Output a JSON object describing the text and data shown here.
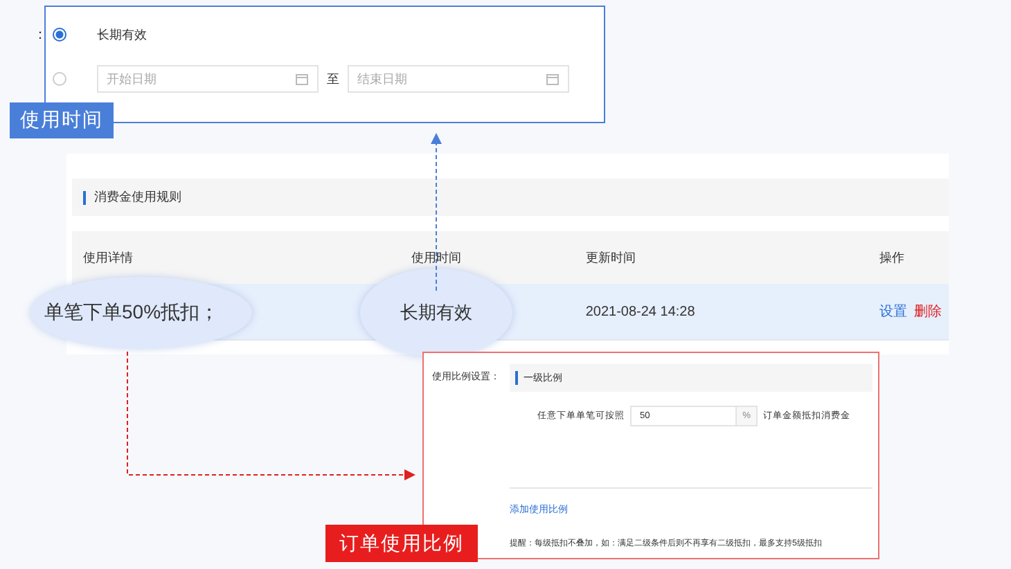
{
  "time_callout": {
    "label_tail": "：",
    "tag": "使用时间",
    "options": [
      {
        "label": "长期有效",
        "selected": true
      },
      {
        "selected": false,
        "start_placeholder": "开始日期",
        "separator": "至",
        "end_placeholder": "结束日期"
      }
    ]
  },
  "rules_panel": {
    "title": "消费金使用规则",
    "columns": [
      "使用详情",
      "使用时间",
      "更新时间",
      "操作"
    ],
    "rows": [
      {
        "selected": true,
        "detail": "单笔下单50%抵扣；",
        "time": "长期有效",
        "updated": "2021-08-24 14:28",
        "actions": [
          {
            "kind": "edit",
            "label": "设置"
          },
          {
            "kind": "delete",
            "label": "删除"
          }
        ]
      }
    ]
  },
  "ratio_callout": {
    "label": "使用比例设置：",
    "section": "一级比例",
    "field_label": "任意下单单笔可按照",
    "value": "50",
    "unit": "%",
    "field_suffix": "订单金额抵扣消费金",
    "add_link": "添加使用比例",
    "tip": "提醒：每级抵扣不叠加，如：满足二级条件后则不再享有二级抵扣，最多支持5级抵扣",
    "tag": "订单使用比例"
  }
}
